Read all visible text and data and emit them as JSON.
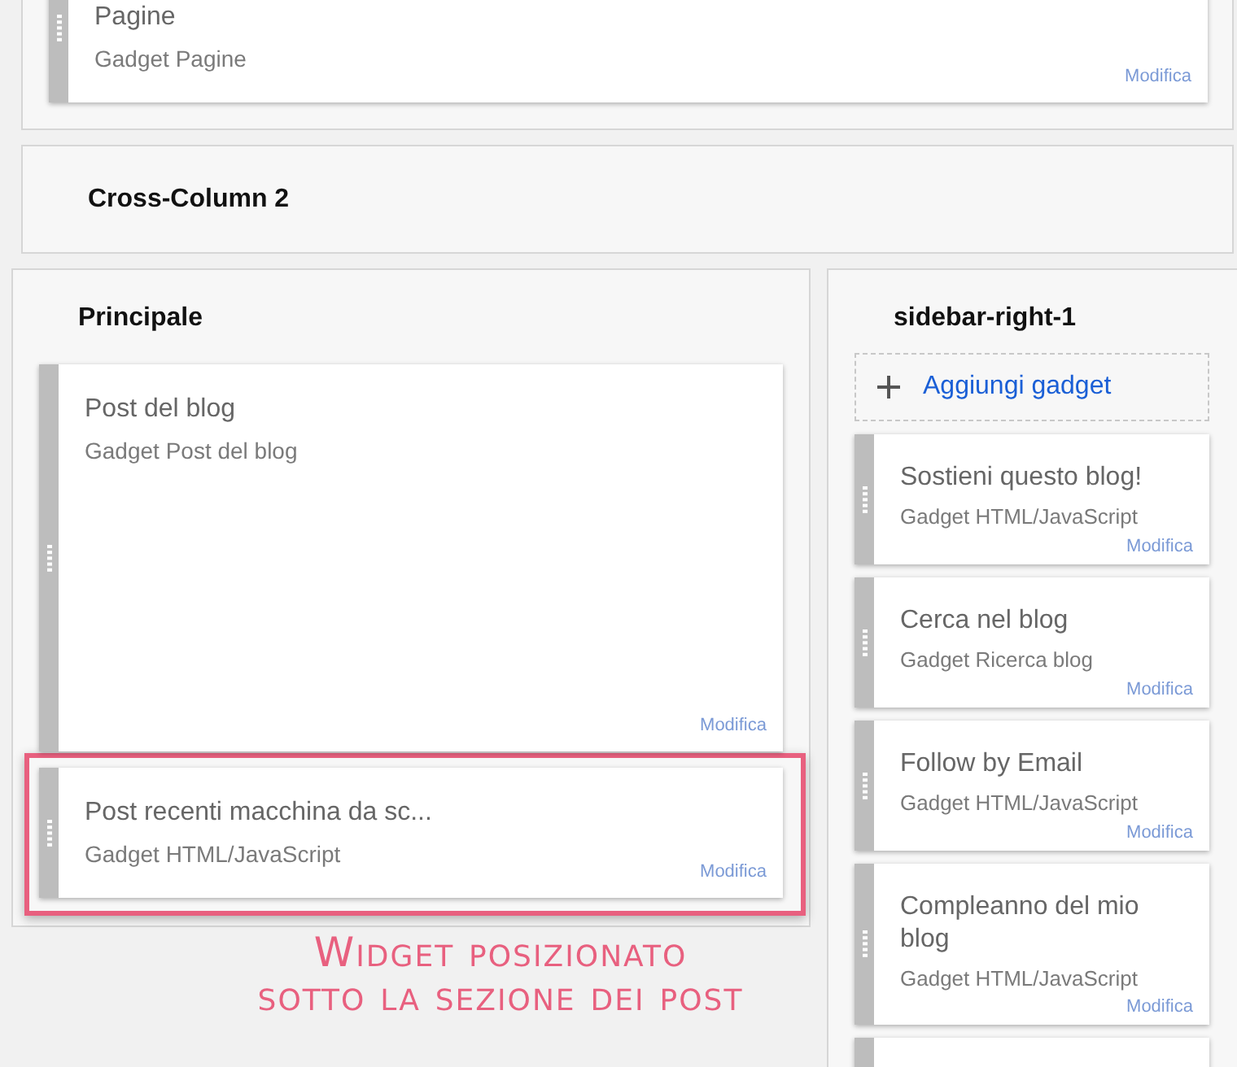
{
  "top_section": {
    "gadgets": [
      {
        "title": "Pagine",
        "subtitle": "Gadget Pagine",
        "edit_link": "Modifica"
      }
    ]
  },
  "cross_column": {
    "title": "Cross-Column 2"
  },
  "main": {
    "title": "Principale",
    "gadgets": [
      {
        "kind": "blog_posts",
        "title": "Post del blog",
        "subtitle": "Gadget Post del blog",
        "edit_link": "Modifica",
        "highlighted": false
      },
      {
        "kind": "html",
        "title": "Post recenti macchina da sc...",
        "subtitle": "Gadget HTML/JavaScript",
        "edit_link": "Modifica",
        "highlighted": true
      }
    ]
  },
  "sidebar": {
    "title": "sidebar-right-1",
    "add_button": "Aggiungi gadget",
    "gadgets": [
      {
        "title": "Sostieni questo blog!",
        "subtitle": "Gadget HTML/JavaScript",
        "edit_link": "Modifica"
      },
      {
        "title": "Cerca nel blog",
        "subtitle": "Gadget Ricerca blog",
        "edit_link": "Modifica"
      },
      {
        "title": "Follow by Email",
        "subtitle": "Gadget HTML/JavaScript",
        "edit_link": "Modifica"
      },
      {
        "title": "Compleanno del mio blog",
        "subtitle": "Gadget HTML/JavaScript",
        "edit_link": "Modifica"
      }
    ]
  },
  "annotation": {
    "lines": [
      "Widget posizionato",
      "sotto la sezione dei post"
    ]
  }
}
